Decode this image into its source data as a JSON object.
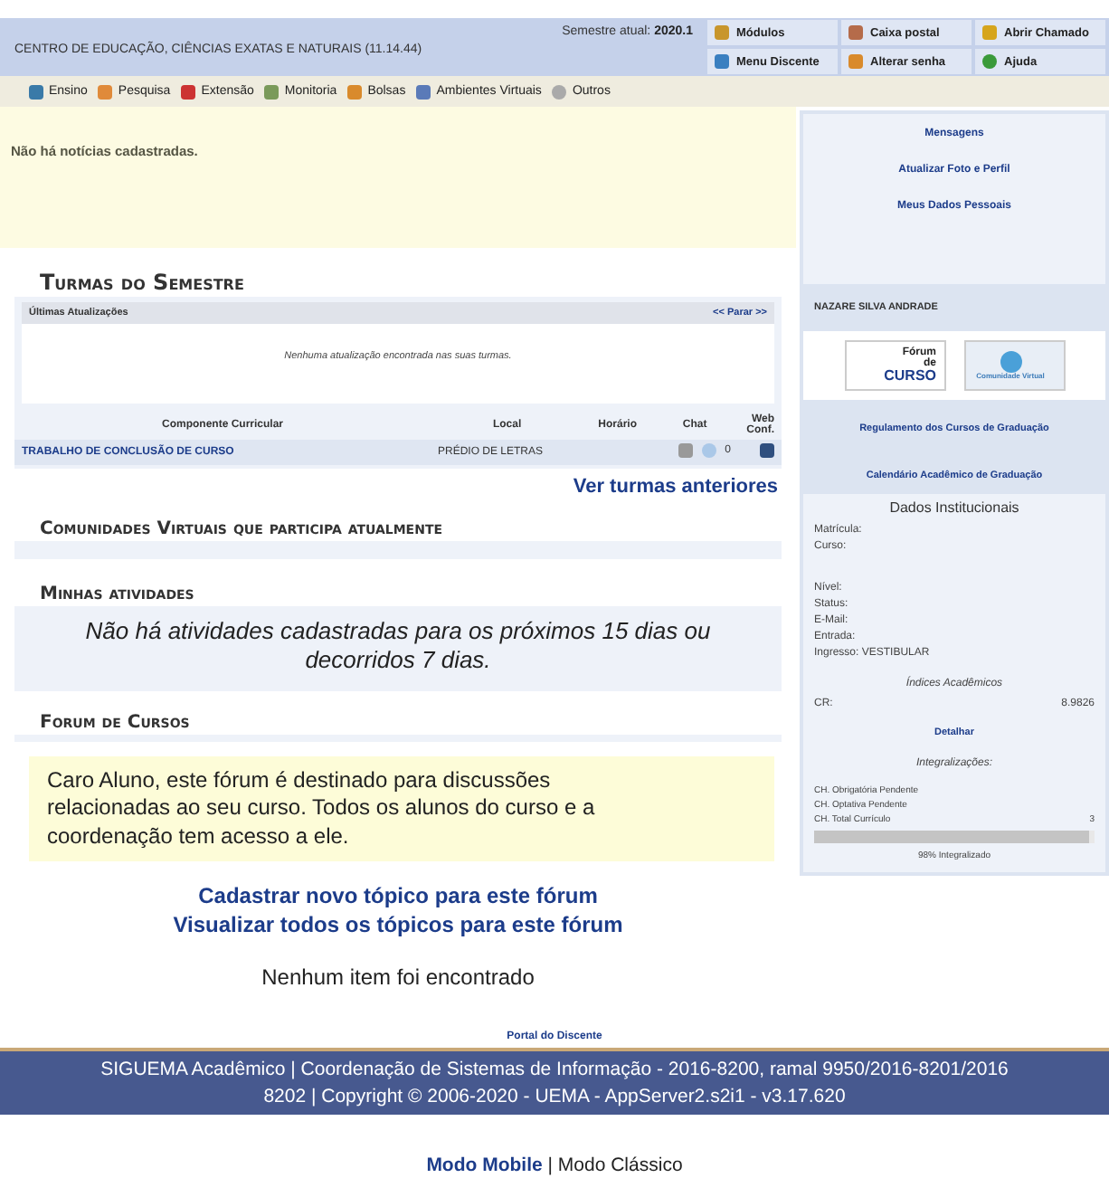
{
  "header": {
    "unit": "CENTRO DE EDUCAÇÃO, CIÊNCIAS EXATAS E NATURAIS (11.14.44)",
    "semester_label": "Semestre atual:",
    "semester": "2020.1",
    "shortcuts": [
      {
        "label": "Módulos"
      },
      {
        "label": "Caixa postal"
      },
      {
        "label": "Abrir Chamado"
      },
      {
        "label": "Menu Discente"
      },
      {
        "label": "Alterar senha"
      },
      {
        "label": "Ajuda"
      }
    ]
  },
  "menu": [
    {
      "label": "Ensino"
    },
    {
      "label": "Pesquisa"
    },
    {
      "label": "Extensão"
    },
    {
      "label": "Monitoria"
    },
    {
      "label": "Bolsas"
    },
    {
      "label": "Ambientes Virtuais"
    },
    {
      "label": "Outros"
    }
  ],
  "news": "Não há notícias cadastradas.",
  "turmas": {
    "title": "Turmas do Semestre",
    "updates_title": "Últimas Atualizações",
    "stop_link": "<< Parar >>",
    "updates_empty": "Nenhuma atualização encontrada nas suas turmas.",
    "columns": [
      "Componente Curricular",
      "Local",
      "Horário",
      "Chat",
      "Web Conf."
    ],
    "rows": [
      {
        "component": "TRABALHO DE CONCLUSÃO DE CURSO",
        "local": "PRÉDIO DE LETRAS",
        "chat_count": "0"
      }
    ],
    "previous_link": "Ver turmas anteriores"
  },
  "communities": {
    "title": "Comunidades Virtuais que participa atualmente"
  },
  "activities": {
    "title": "Minhas atividades",
    "empty": "Não há atividades cadastradas para os próximos 15 dias ou decorridos 7 dias."
  },
  "forum": {
    "title": "Forum de Cursos",
    "notice": "Caro Aluno, este fórum é destinado para discussões relacionadas ao seu curso. Todos os alunos do curso e a coordenação tem acesso a ele.",
    "links": [
      "Cadastrar novo tópico para este fórum",
      "Visualizar todos os tópicos para este fórum"
    ],
    "empty": "Nenhum item foi encontrado"
  },
  "sidebar": {
    "links": [
      "Mensagens",
      "Atualizar Foto e Perfil",
      "Meus Dados Pessoais"
    ],
    "student": "NAZARE SILVA ANDRADE",
    "forum_badge": [
      "Fórum",
      "de",
      "CURSO"
    ],
    "community_badge": "Comunidade Virtual",
    "doc_links": [
      "Regulamento dos Cursos de Graduação",
      "Calendário Acadêmico de Graduação"
    ],
    "data_title": "Dados Institucionais",
    "fields": [
      {
        "label": "Matrícula:"
      },
      {
        "label": "Curso:"
      },
      {
        "label": "Nível:"
      },
      {
        "label": "Status:"
      },
      {
        "label": "E-Mail:"
      },
      {
        "label": "Entrada:"
      },
      {
        "label": "Ingresso:",
        "value": "VESTIBULAR"
      }
    ],
    "indices_title": "Índices Acadêmicos",
    "cr_label": "CR:",
    "cr_value": "8.9826",
    "detail_link": "Detalhar",
    "integ_title": "Integralizações:",
    "integ_rows": [
      {
        "label": "CH. Obrigatória Pendente"
      },
      {
        "label": "CH. Optativa Pendente"
      },
      {
        "label": "CH. Total Currículo",
        "value": "3"
      }
    ],
    "progress": {
      "level": 0.98,
      "caption": "98% Integralizado"
    }
  },
  "footer": {
    "portal": "Portal do Discente",
    "lines": [
      "SIGUEMA Acadêmico | Coordenação de Sistemas de Informação - 2016-8200, ramal 9950/2016-8201/2016",
      "8202 | Copyright © 2006-2020 - UEMA - AppServer2.s2i1 - v3.17.620"
    ],
    "modes": [
      {
        "label": "Modo Mobile",
        "selected": true
      },
      {
        "label": "Modo Clássico",
        "selected": false
      }
    ],
    "mode_separator": "|"
  }
}
